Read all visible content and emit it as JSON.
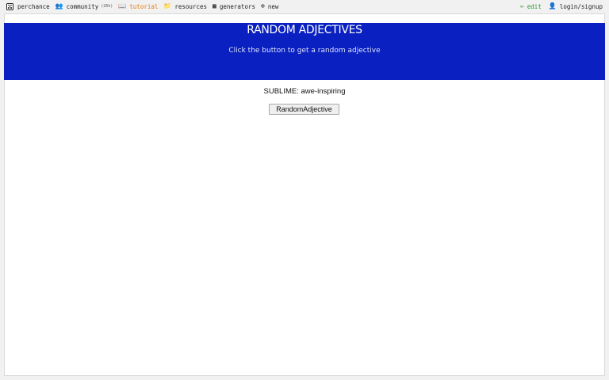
{
  "topbar": {
    "brand": {
      "label": "perchance",
      "icon": "dice-icon"
    },
    "items": [
      {
        "label": "community",
        "badge": "(26h)",
        "icon": "people-icon"
      },
      {
        "label": "tutorial",
        "icon": "book-icon",
        "active": true
      },
      {
        "label": "resources",
        "icon": "folder-icon"
      },
      {
        "label": "generators",
        "icon": "grid-icon"
      },
      {
        "label": "new",
        "icon": "plus-circle-icon"
      }
    ],
    "edit": {
      "label": "edit",
      "icon": "pencil-icon"
    },
    "login": {
      "label": "login/signup",
      "icon": "user-icon"
    }
  },
  "header": {
    "title": "RANDOM ADJECTIVES",
    "subtitle": "Click the button to get a random adjective"
  },
  "result": {
    "text": "SUBLIME: awe-inspiring"
  },
  "button": {
    "label": "RandomAdjective"
  },
  "colors": {
    "header_bg": "#0a20c0",
    "active_nav": "#e8780a",
    "edit": "#2c9a2c"
  }
}
